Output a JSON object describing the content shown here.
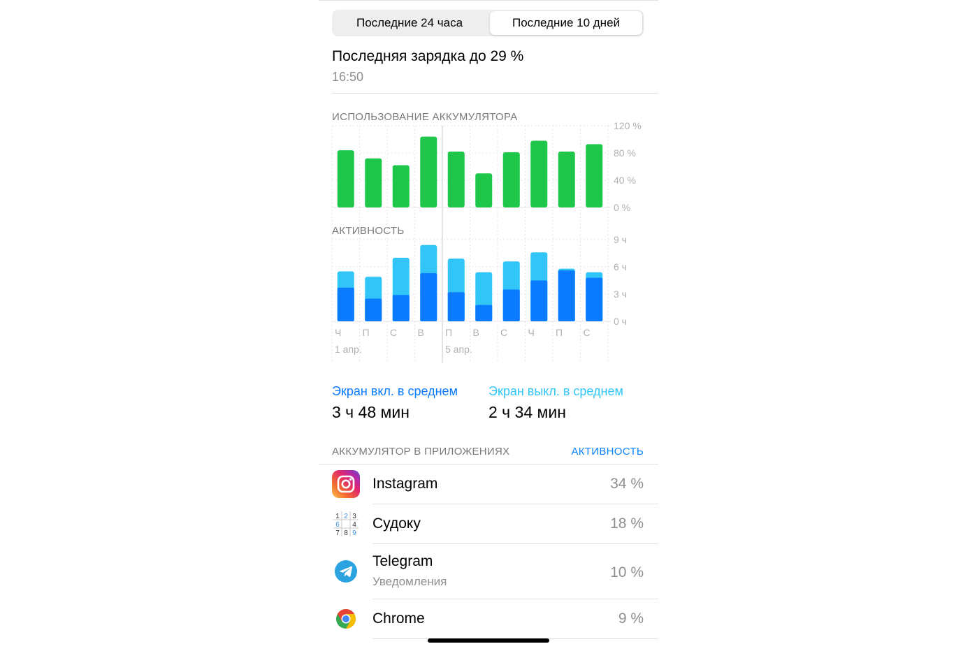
{
  "segmented": {
    "options": [
      "Последние 24 часа",
      "Последние 10 дней"
    ],
    "selected": "Последние 10 дней"
  },
  "last_charge": {
    "title": "Последняя зарядка до 29 %",
    "time": "16:50"
  },
  "battery_usage": {
    "label": "ИСПОЛЬЗОВАНИЕ АККУМУЛЯТОРА",
    "y_ticks": [
      "120 %",
      "80 %",
      "40 %",
      "0 %"
    ],
    "y_max": 120,
    "values": [
      84,
      72,
      62,
      104,
      82,
      50,
      81,
      98,
      82,
      93
    ],
    "color": "#1ec74a"
  },
  "activity": {
    "label": "АКТИВНОСТЬ",
    "y_ticks": [
      "9 ч",
      "6 ч",
      "3 ч",
      "0 ч"
    ],
    "y_max": 9,
    "screen_on": [
      3.7,
      2.5,
      2.9,
      5.3,
      3.2,
      1.8,
      3.5,
      4.5,
      5.6,
      4.8
    ],
    "screen_off": [
      1.8,
      2.4,
      4.1,
      3.1,
      3.7,
      3.6,
      3.1,
      3.1,
      0.2,
      0.6
    ],
    "on_color": "#0a7aff",
    "off_color": "#31c6f7"
  },
  "x_axis": {
    "days": [
      "Ч",
      "П",
      "С",
      "В",
      "П",
      "В",
      "С",
      "Ч",
      "П",
      "С"
    ],
    "dates": [
      {
        "index": 0,
        "label": "1 апр."
      },
      {
        "index": 4,
        "label": "5 апр."
      }
    ]
  },
  "averages": {
    "on_label": "Экран вкл. в среднем",
    "on_value": "3 ч 48 мин",
    "off_label": "Экран выкл. в среднем",
    "off_value": "2 ч 34 мин"
  },
  "apps": {
    "header": "АККУМУЛЯТОР В ПРИЛОЖЕНИЯХ",
    "toggle": "АКТИВНОСТЬ",
    "items": [
      {
        "name": "Instagram",
        "subtitle": "",
        "percent": "34 %",
        "icon": "instagram-icon"
      },
      {
        "name": "Судоку",
        "subtitle": "",
        "percent": "18 %",
        "icon": "sudoku-icon",
        "icon_digits": [
          "1",
          "2",
          "3",
          "6",
          "",
          "4",
          "7",
          "8",
          "9"
        ]
      },
      {
        "name": "Telegram",
        "subtitle": "Уведомления",
        "percent": "10 %",
        "icon": "telegram-icon"
      },
      {
        "name": "Chrome",
        "subtitle": "",
        "percent": "9 %",
        "icon": "chrome-icon"
      }
    ]
  }
}
